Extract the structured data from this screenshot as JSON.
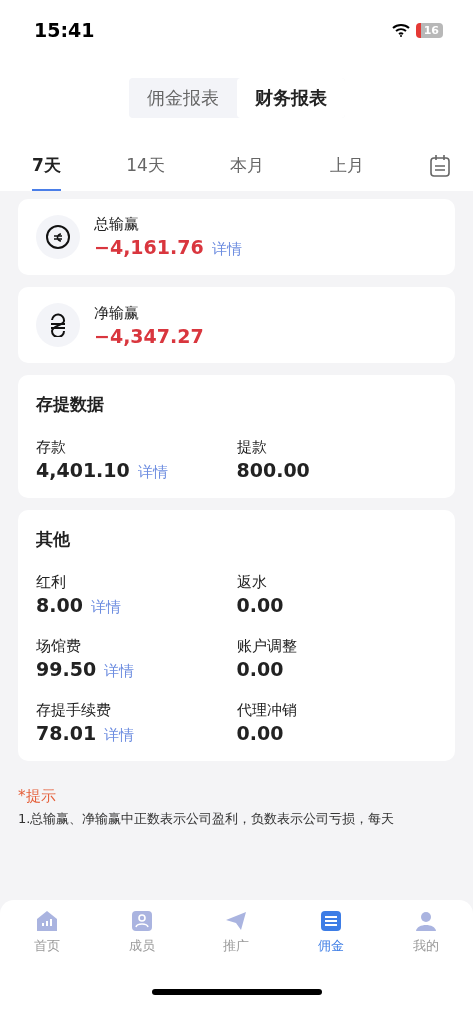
{
  "status_bar": {
    "time": "15:41",
    "battery": "16"
  },
  "report_tabs": [
    {
      "label": "佣金报表",
      "selected": false
    },
    {
      "label": "财务报表",
      "selected": true
    }
  ],
  "period_tabs": [
    {
      "label": "7天",
      "selected": true
    },
    {
      "label": "14天",
      "selected": false
    },
    {
      "label": "本月",
      "selected": false
    },
    {
      "label": "上月",
      "selected": false
    }
  ],
  "summary_cards": [
    {
      "label": "总输赢",
      "value": "−4,161.76",
      "link": "详情"
    },
    {
      "label": "净输赢",
      "value": "−4,347.27"
    }
  ],
  "sections": [
    {
      "title": "存提数据",
      "items": [
        {
          "label": "存款",
          "value": "4,401.10",
          "link": "详情"
        },
        {
          "label": "提款",
          "value": "800.00"
        }
      ]
    },
    {
      "title": "其他",
      "items": [
        {
          "label": "红利",
          "value": "8.00",
          "link": "详情"
        },
        {
          "label": "返水",
          "value": "0.00"
        },
        {
          "label": "场馆费",
          "value": "99.50",
          "link": "详情"
        },
        {
          "label": "账户调整",
          "value": "0.00"
        },
        {
          "label": "存提手续费",
          "value": "78.01",
          "link": "详情"
        },
        {
          "label": "代理冲销",
          "value": "0.00"
        }
      ]
    }
  ],
  "hint": {
    "title": "*提示",
    "text": "1.总输赢、净输赢中正数表示公司盈利，负数表示公司亏损，每天"
  },
  "bottom_nav": [
    {
      "label": "首页",
      "selected": false
    },
    {
      "label": "成员",
      "selected": false
    },
    {
      "label": "推广",
      "selected": false
    },
    {
      "label": "佣金",
      "selected": true
    },
    {
      "label": "我的",
      "selected": false
    }
  ]
}
